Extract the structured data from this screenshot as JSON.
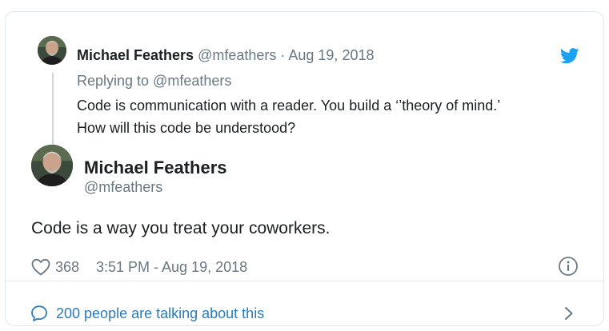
{
  "parent_tweet": {
    "author_name": "Michael Feathers",
    "meta": "@mfeathers · Aug 19, 2018",
    "replying_to": "Replying to @mfeathers",
    "body_line_1": "Code is communication with a reader. You build a ‘’theory of mind.’",
    "body_line_2": "How will this code be understood?",
    "avatar_icon": "avatar-photo"
  },
  "main_tweet": {
    "author_name": "Michael Feathers",
    "handle": "@mfeathers",
    "body": "Code is a way you treat your coworkers.",
    "like_count": "368",
    "timestamp": "3:51 PM - Aug 19, 2018",
    "avatar_icon": "avatar-photo"
  },
  "footer": {
    "talking_label": "200 people are talking about this"
  },
  "icons": {
    "brand": "twitter-bird-icon",
    "like": "heart-icon",
    "info": "info-icon",
    "reply": "speech-bubble-icon",
    "more": "chevron-right-icon"
  },
  "colors": {
    "twitter_blue": "#1da1f2",
    "link_blue": "#2b7bb9",
    "muted_text": "#697882",
    "body_text": "#1c2022",
    "border": "#e1e8ed"
  }
}
